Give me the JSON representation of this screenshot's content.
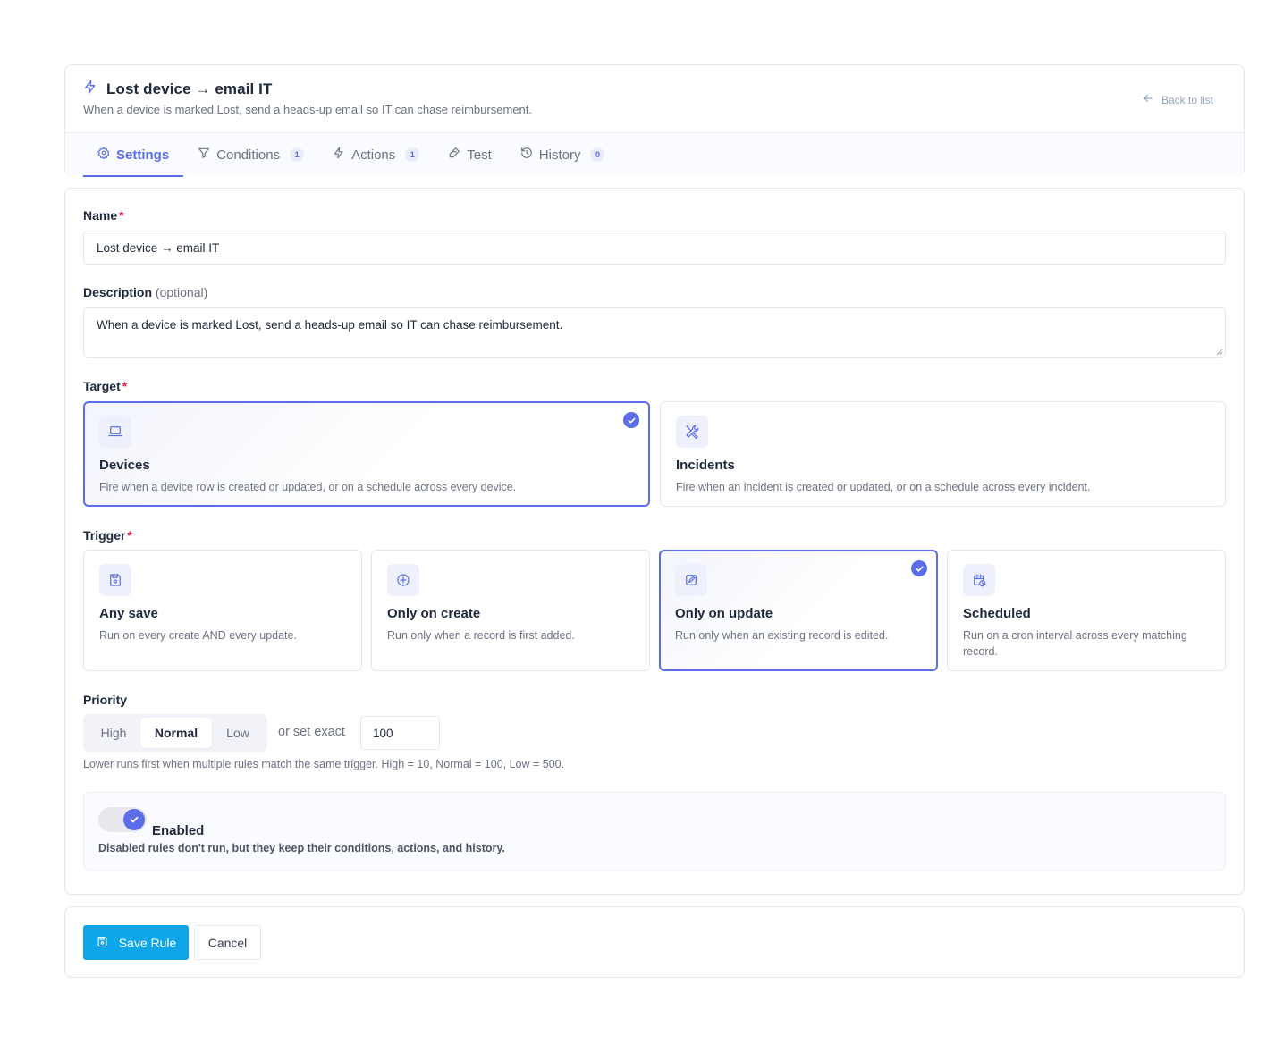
{
  "header": {
    "title": "Lost device → email IT",
    "subtitle": "When a device is marked Lost, send a heads-up email so IT can chase reimbursement.",
    "back_label": "Back to list",
    "icon": "bolt-icon"
  },
  "tabs": [
    {
      "label": "Settings",
      "count": null,
      "icon": "gear-icon",
      "active": true
    },
    {
      "label": "Conditions",
      "count": "1",
      "icon": "filter-icon"
    },
    {
      "label": "Actions",
      "count": "1",
      "icon": "bolt-icon"
    },
    {
      "label": "Test",
      "count": null,
      "icon": "flask-icon"
    },
    {
      "label": "History",
      "count": "0",
      "icon": "history-icon"
    }
  ],
  "form": {
    "name_label": "Name",
    "required_mark": "*",
    "name_value": "Lost device → email IT",
    "description_label": "Description",
    "description_optional": "(optional)",
    "description_value": "When a device is marked Lost, send a heads-up email so IT can chase reimbursement.",
    "target_label": "Target",
    "targets": [
      {
        "title": "Devices",
        "desc": "Fire when a device row is created or updated, or on a schedule across every device.",
        "icon": "laptop-icon",
        "selected": true
      },
      {
        "title": "Incidents",
        "desc": "Fire when an incident is created or updated, or on a schedule across every incident.",
        "icon": "tools-icon",
        "selected": false
      }
    ],
    "trigger_label": "Trigger",
    "triggers": [
      {
        "title": "Any save",
        "desc": "Run on every create AND every update.",
        "icon": "save-icon",
        "selected": false
      },
      {
        "title": "Only on create",
        "desc": "Run only when a record is first added.",
        "icon": "plus-circle-icon",
        "selected": false
      },
      {
        "title": "Only on update",
        "desc": "Run only when an existing record is edited.",
        "icon": "edit-icon",
        "selected": true
      },
      {
        "title": "Scheduled",
        "desc": "Run on a cron interval across every matching record.",
        "icon": "calendar-clock-icon",
        "selected": false
      }
    ],
    "priority_label": "Priority",
    "priority_options": [
      "High",
      "Normal",
      "Low"
    ],
    "priority_selected": "Normal",
    "exact_label": "or set exact",
    "exact_value": "100",
    "priority_help": "Lower runs first when multiple rules match the same trigger. High = 10, Normal = 100, Low = 500.",
    "enabled_title": "Enabled",
    "enabled_desc": "Disabled rules don't run, but they keep their conditions, actions, and history.",
    "enabled": true
  },
  "footer": {
    "save_label": "Save Rule",
    "cancel_label": "Cancel"
  },
  "colors": {
    "accent": "#5b6de8",
    "primary_button": "#0ea5e9",
    "required": "#e11d48"
  }
}
